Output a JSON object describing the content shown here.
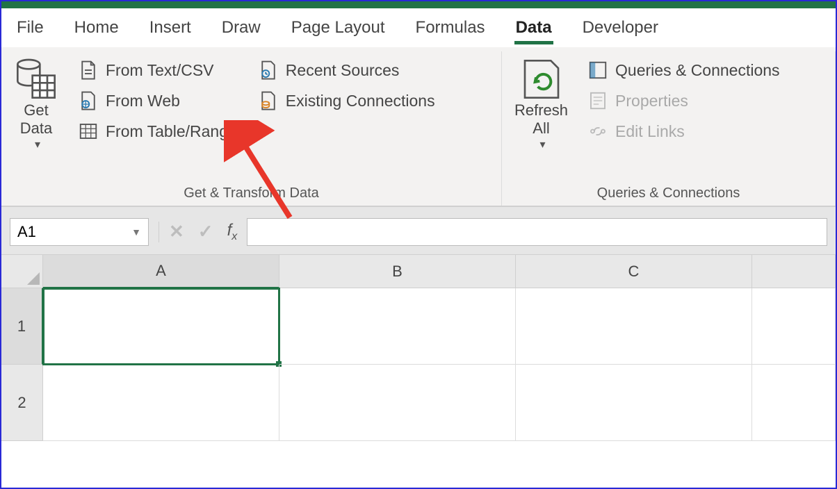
{
  "tabs": {
    "file": "File",
    "home": "Home",
    "insert": "Insert",
    "draw": "Draw",
    "page_layout": "Page Layout",
    "formulas": "Formulas",
    "data": "Data",
    "developer": "Developer"
  },
  "ribbon": {
    "group1": {
      "label": "Get & Transform Data",
      "get_data": "Get\nData",
      "from_text_csv": "From Text/CSV",
      "from_web": "From Web",
      "from_table_range": "From Table/Range",
      "recent_sources": "Recent Sources",
      "existing_connections": "Existing Connections"
    },
    "group2": {
      "label": "Queries & Connections",
      "refresh_all": "Refresh\nAll",
      "queries_connections": "Queries & Connections",
      "properties": "Properties",
      "edit_links": "Edit Links"
    }
  },
  "formula_bar": {
    "name_box": "A1",
    "formula": ""
  },
  "sheet": {
    "columns": [
      "A",
      "B",
      "C",
      ""
    ],
    "rows": [
      "1",
      "2"
    ],
    "selected_cell": "A1"
  },
  "colors": {
    "accent": "#217346",
    "arrow": "#E8362A"
  }
}
